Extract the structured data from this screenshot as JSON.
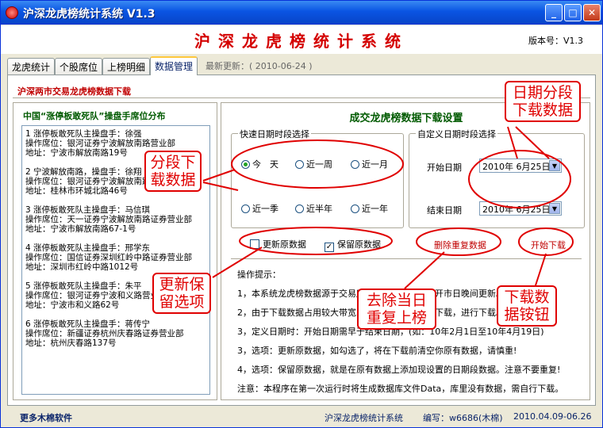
{
  "window": {
    "title": "沪深龙虎榜统计系统 V1.3",
    "min": "_",
    "max": "□",
    "close": "✕"
  },
  "banner": {
    "title": "沪深龙虎榜统计系统",
    "version": "版本号：V1.3"
  },
  "tabs": [
    "龙虎统计",
    "个股席位",
    "上榜明细",
    "数据管理"
  ],
  "latest_update": "最新更新：( 2010-06-24 )",
  "section_title": "沪深两市交易龙虎榜数据下载",
  "left_panel": {
    "title": "中国“涨停板敢死队”操盘手席位分布",
    "brokers": [
      {
        "name": "1 涨停板敢死队主操盘手：徐强",
        "seat": "操作席位：银河证券宁波解放南路营业部",
        "addr": "地址：宁波市解放南路19号"
      },
      {
        "name": "2 宁波解放南路，操盘手：徐翔",
        "seat": "操作席位：银河证券宁波解放南路",
        "addr": "地址：桂林市环城北路46号"
      },
      {
        "name": "3 涨停板敢死队主操盘手：马信琪",
        "seat": "操作席位：天一证券宁波解放南路证券营业部",
        "addr": "地址：宁波市解放南路67-1号"
      },
      {
        "name": "4 涨停板敢死队主操盘手：邢学东",
        "seat": "操作席位：国信证券深圳红岭中路证券营业部",
        "addr": "地址：深圳市红岭中路1012号"
      },
      {
        "name": "5 涨停板敢死队主操盘手：朱平",
        "seat": "操作席位：银河证券宁波和义路营业部",
        "addr": "地址：宁波市和义路62号"
      },
      {
        "name": "6 涨停板敢死队主操盘手：蒋传宁",
        "seat": "操作席位：新疆证券杭州庆春路证券营业部",
        "addr": "地址：杭州庆春路137号"
      }
    ]
  },
  "right_panel": {
    "title": "成交龙虎榜数据下载设置",
    "quick_group": "快速日期时段选择",
    "quick_options": [
      "今　天",
      "近一周",
      "近一月",
      "近一季",
      "近半年",
      "近一年"
    ],
    "custom_group": "自定义日期时段选择",
    "start_label": "开始日期",
    "start_date": "2010年 6月25日",
    "end_label": "结束日期",
    "end_date": "2010年 6月25日",
    "update_original": "更新原数据",
    "keep_original": "保留原数据",
    "delete_dup": "删除重复数据",
    "start_download": "开始下载",
    "tips_title": "操作提示：",
    "tips": [
      "1，本系统龙虎榜数据源于交易所，每天收盘后数据开市日晚间更新。",
      "2，由于下载数据占用较大带宽，请在网络空闲时间下载，进行下载。",
      "3，定义日期时：开始日期需早于结束日期，(如：10年2月1日至10年4月19日)",
      "3，选项：更新原数据，如勾选了，将在下载前清空你原有数据，请慎重!",
      "4，选项：保留原数据，就是在原有数据上添加现设置的日期段数据。注意不要重复!",
      "注意：本程序在第一次运行时将生成数据库文件Data，库里没有数据，需自行下载。"
    ]
  },
  "footer": {
    "more": "更多木棉软件",
    "app": "沪深龙虎榜统计系统",
    "author": "编写：w6686(木棉)",
    "dates": "2010.04.09-06.26"
  },
  "annotations": {
    "date_range": "日期分段下载数据",
    "segment": "分段下载数据",
    "update_keep": "更新保留选项",
    "dedupe": "去除当日重复上榜",
    "download_btn": "下载数据铵钮"
  },
  "colors": {
    "annotation": "#e00000",
    "title_red": "#d40000",
    "heading_green": "#005a00",
    "titlebar": "#0A55E3"
  }
}
